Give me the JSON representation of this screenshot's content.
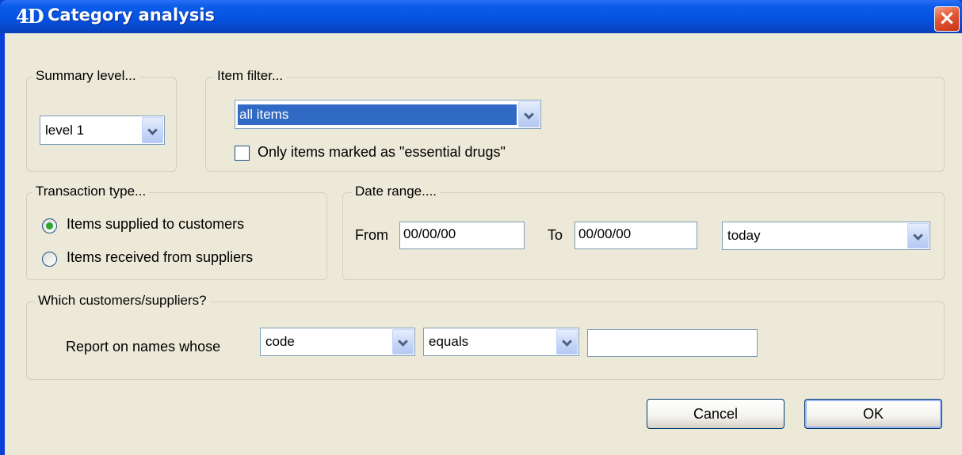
{
  "window": {
    "logo": "4D",
    "title": "Category analysis",
    "close_symbol": "×"
  },
  "summary": {
    "legend": "Summary level...",
    "selected": "level 1"
  },
  "item_filter": {
    "legend": "Item filter...",
    "selected": "all items",
    "essential_label": "Only items marked as \"essential drugs\"",
    "essential_checked": false
  },
  "transaction": {
    "legend": "Transaction type...",
    "options": [
      {
        "label": "Items supplied to customers",
        "selected": true
      },
      {
        "label": "Items received from suppliers",
        "selected": false
      }
    ]
  },
  "date_range": {
    "legend": "Date range....",
    "from_label": "From",
    "from_value": "00/00/00",
    "to_label": "To",
    "to_value": "00/00/00",
    "preset": "today"
  },
  "which": {
    "legend": "Which customers/suppliers?",
    "report_label": "Report on names whose",
    "field": "code",
    "operator": "equals",
    "value": ""
  },
  "buttons": {
    "cancel": "Cancel",
    "ok": "OK"
  },
  "colors": {
    "titlebar": "#0552e2",
    "dialog_bg": "#ece9d8",
    "selection": "#316ac5",
    "close": "#e35a36",
    "radio_dot": "#2fa52f"
  }
}
